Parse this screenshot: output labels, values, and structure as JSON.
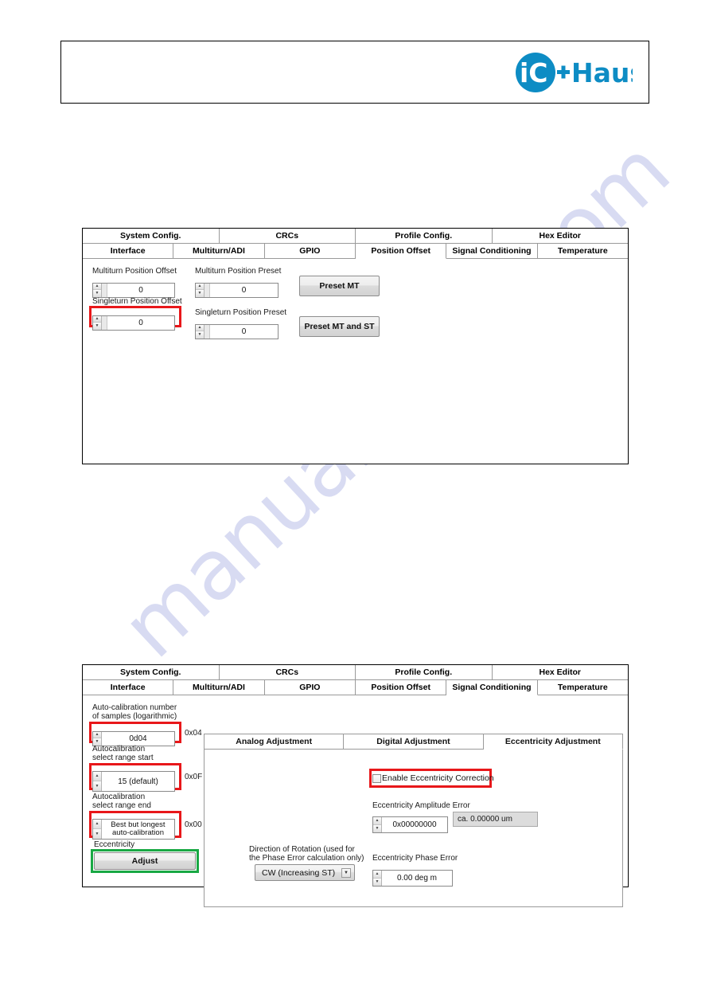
{
  "watermark": {
    "text": "manualshive.com"
  },
  "header": {
    "logo_name": "ic-haus-logo",
    "logo_text_ic": "iC",
    "logo_text_haus": "Haus",
    "brand_color": "#0d8cc4"
  },
  "colors": {
    "highlight_red": "#e8171a",
    "highlight_green": "#19a844"
  },
  "panel_position_offset": {
    "tabs_row1": [
      {
        "label": "System Config."
      },
      {
        "label": "CRCs"
      },
      {
        "label": "Profile Config."
      },
      {
        "label": "Hex Editor"
      }
    ],
    "tabs_row2": [
      {
        "label": "Interface"
      },
      {
        "label": "Multiturn/ADI"
      },
      {
        "label": "GPIO"
      },
      {
        "label": "Position Offset",
        "active": true
      },
      {
        "label": "Signal Conditioning"
      },
      {
        "label": "Temperature"
      }
    ],
    "fields": [
      {
        "label": "Multiturn Position Offset",
        "value": "0",
        "highlight": "none"
      },
      {
        "label": "Multiturn Position Preset",
        "value": "0",
        "highlight": "none"
      },
      {
        "label": "Singleturn Position Offset",
        "value": "0",
        "highlight": "red"
      },
      {
        "label": "Singleturn Position Preset",
        "value": "0",
        "highlight": "none"
      }
    ],
    "buttons": [
      {
        "label": "Preset MT"
      },
      {
        "label": "Preset MT and ST"
      }
    ]
  },
  "panel_signal_conditioning": {
    "tabs_row1": [
      {
        "label": "System Config."
      },
      {
        "label": "CRCs"
      },
      {
        "label": "Profile Config."
      },
      {
        "label": "Hex Editor"
      }
    ],
    "tabs_row2": [
      {
        "label": "Interface"
      },
      {
        "label": "Multiturn/ADI"
      },
      {
        "label": "GPIO"
      },
      {
        "label": "Position Offset"
      },
      {
        "label": "Signal Conditioning",
        "active": true
      },
      {
        "label": "Temperature"
      }
    ],
    "sidebar": {
      "autocal_samples": {
        "label_line1": "Auto-calibration number",
        "label_line2": "of samples (logarithmic)",
        "value": "0d04",
        "hex": "0x04"
      },
      "autocal_range_start": {
        "label_line1": "Autocalibration",
        "label_line2": "select range start",
        "value": "15 (default)",
        "hex": "0x0F"
      },
      "autocal_range_end": {
        "label_line1": "Autocalibration",
        "label_line2": "select range end",
        "value_line1": "Best but longest",
        "value_line2": "auto-calibration",
        "hex": "0x00"
      },
      "eccentricity": {
        "group_label": "Eccentricity",
        "button_label": "Adjust"
      }
    },
    "inner_tabs": [
      {
        "label": "Analog Adjustment"
      },
      {
        "label": "Digital Adjustment"
      },
      {
        "label": "Eccentricity Adjustment",
        "active": true
      }
    ],
    "eccentricity_panel": {
      "enable_checkbox_label": "Enable Eccentricity Correction",
      "enable_checkbox_checked": false,
      "amplitude_error_label": "Eccentricity Amplitude Error",
      "amplitude_error_value": "0x00000000",
      "amplitude_error_readout": "ca. 0.00000 um",
      "direction_label_line1": "Direction of Rotation (used for",
      "direction_label_line2": "the Phase Error calculation only)",
      "direction_value": "CW (Increasing ST)",
      "phase_error_label": "Eccentricity Phase Error",
      "phase_error_value": "0.00 deg m"
    }
  }
}
